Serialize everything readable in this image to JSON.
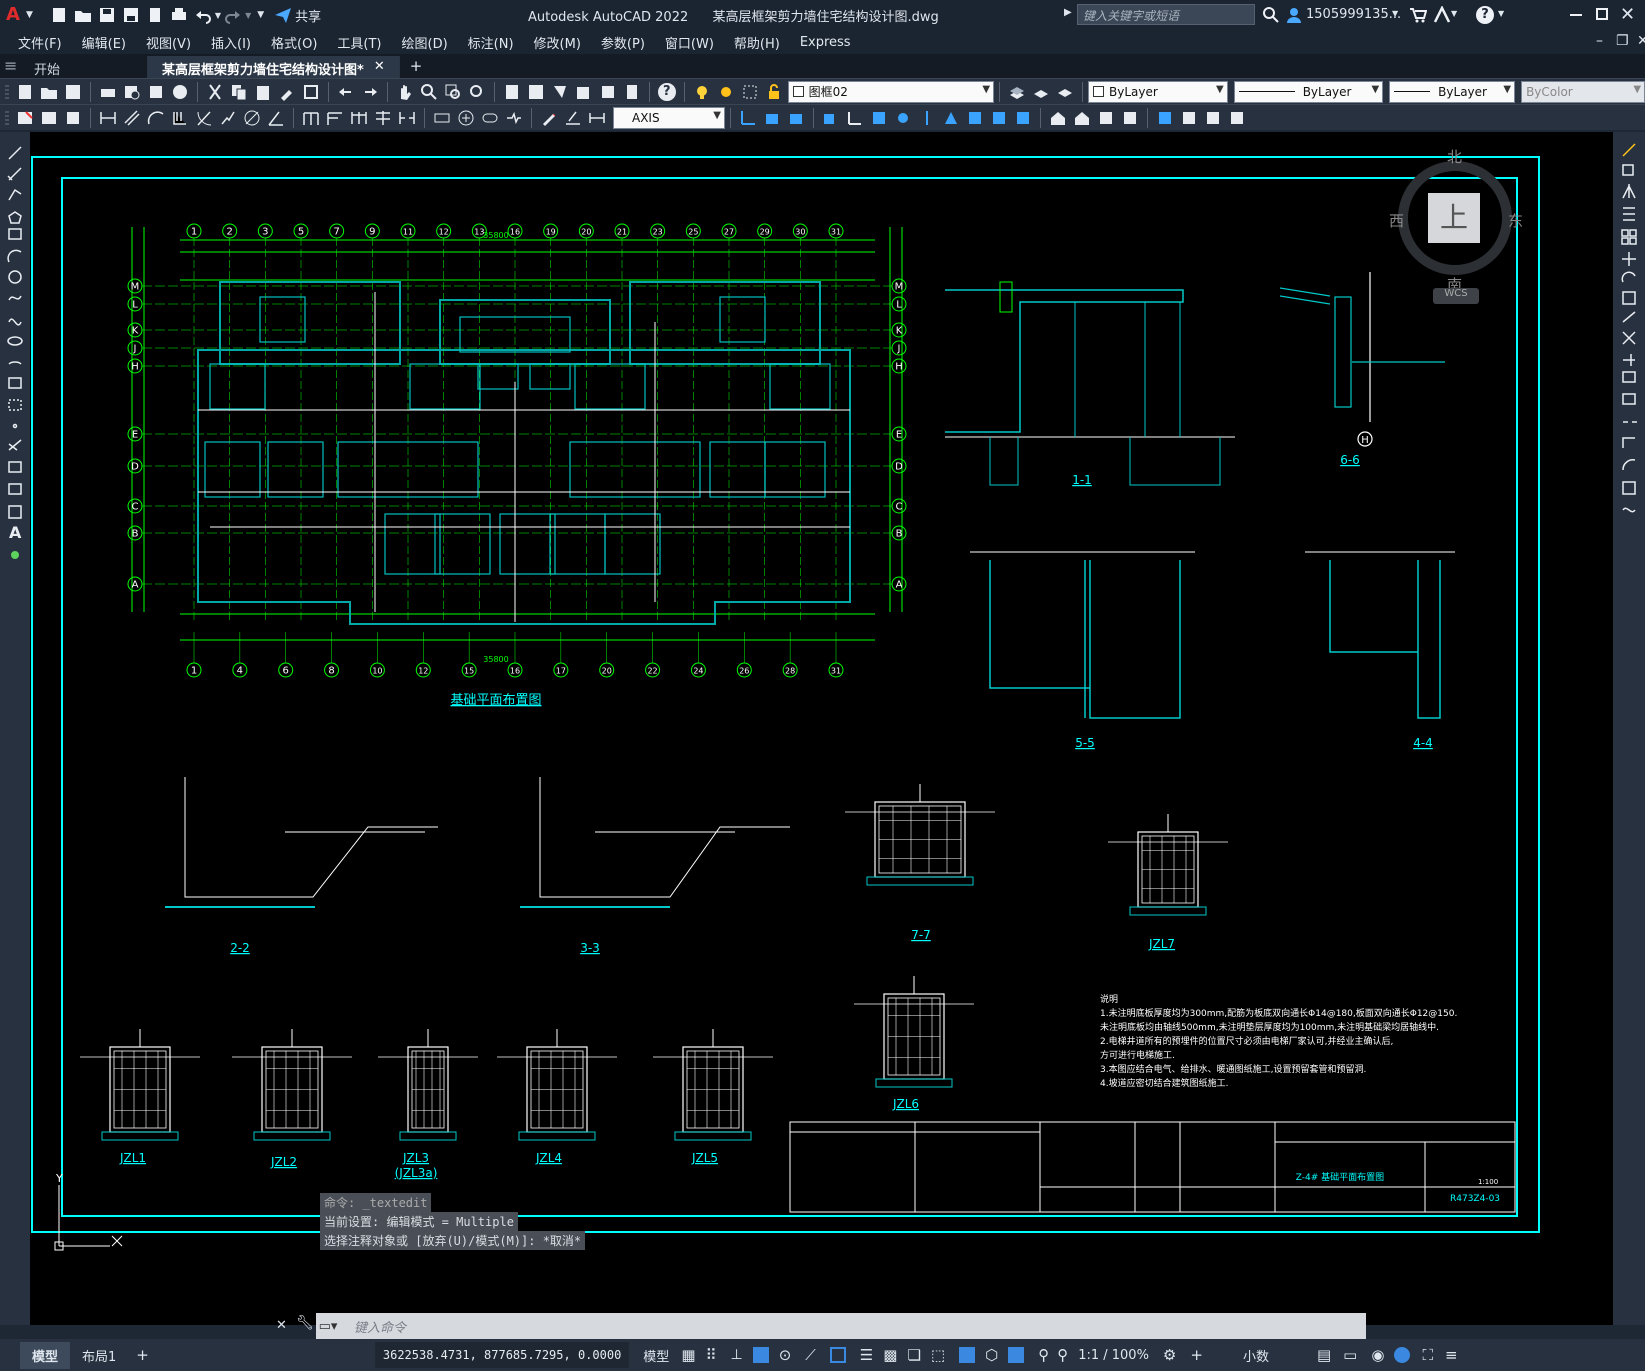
{
  "title_bar": {
    "app_title": "Autodesk AutoCAD 2022",
    "file_title": "某高层框架剪力墙住宅结构设计图.dwg",
    "share_label": "共享",
    "search_placeholder": "键入关键字或短语",
    "user_name": "1505999135...",
    "help_glyph": "?"
  },
  "menu": [
    "文件(F)",
    "编辑(E)",
    "视图(V)",
    "插入(I)",
    "格式(O)",
    "工具(T)",
    "绘图(D)",
    "标注(N)",
    "修改(M)",
    "参数(P)",
    "窗口(W)",
    "帮助(H)",
    "Express"
  ],
  "doc_tabs": [
    {
      "label": "开始",
      "active": false
    },
    {
      "label": "某高层框架剪力墙住宅结构设计图*",
      "active": true
    }
  ],
  "toolbar": {
    "layer": "图框02",
    "color": "ByLayer",
    "linetype": "ByLayer",
    "lineweight": "ByLayer",
    "plotstyle": "ByColor",
    "textstyle": "AXIS"
  },
  "viewcube": {
    "north": "北",
    "south": "南",
    "east": "东",
    "west": "西",
    "top": "上",
    "wcs": "WCS"
  },
  "command_history": [
    "命令: _textedit",
    "当前设置: 编辑模式 = Multiple",
    "选择注释对象或 [放弃(U)/模式(M)]: *取消*"
  ],
  "command_placeholder": "键入命令",
  "status": {
    "tabs": [
      "模型",
      "布局1"
    ],
    "coords": "3622538.4731, 877685.7295, 0.0000",
    "mode": "模型",
    "scale": "1:1 / 100%",
    "units": "小数"
  },
  "drawing": {
    "plan_title": "基础平面布置图",
    "top_axes": [
      "1",
      "2",
      "3",
      "5",
      "7",
      "9",
      "11",
      "12",
      "13",
      "16",
      "19",
      "20",
      "21",
      "23",
      "25",
      "27",
      "29",
      "30",
      "31"
    ],
    "bottom_axes": [
      "1",
      "4",
      "6",
      "8",
      "10",
      "12",
      "15",
      "16",
      "17",
      "20",
      "22",
      "24",
      "26",
      "28",
      "31"
    ],
    "row_axes": [
      "M",
      "L",
      "K",
      "J",
      "H",
      "E",
      "D",
      "C",
      "B",
      "A"
    ],
    "top_total": "35800",
    "bottom_total": "35800",
    "section_titles": [
      "1-1",
      "6-6",
      "5-5",
      "4-4",
      "2-2",
      "3-3",
      "7-7",
      "JZL7",
      "JZL6",
      "JZL1",
      "JZL2",
      "JZL3",
      "(JZL3a)",
      "JZL4",
      "JZL5"
    ],
    "axis_h": "H",
    "notes": [
      "说明",
      "1.未注明底板厚度均为300mm,配筋为板底双向通长Φ14@180,板面双向通长Φ12@150.",
      "  未注明底板均由轴线500mm,未注明垫层厚度均为100mm,未注明基础梁均居轴线中.",
      "2.电梯井道所有的预埋件的位置尺寸必须由电梯厂家认可,并经业主确认后,",
      "  方可进行电梯施工.",
      "3.本图应结合电气、给排水、暖通图纸施工,设置预留套管和预留洞.",
      "4.坡道应密切结合建筑图纸施工."
    ],
    "titleblock": {
      "drawing_name": "Z-4# 基础平面布置图",
      "drawing_no": "R473Z4-03",
      "scale": "1:100"
    }
  }
}
